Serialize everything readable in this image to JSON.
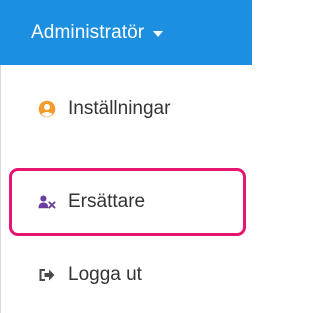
{
  "header": {
    "label": "Administratör",
    "caret_icon": "caret-down-icon",
    "background_color": "#1d8fe0"
  },
  "menu": {
    "items": [
      {
        "label": "Inställningar",
        "icon": "user-circle-icon",
        "icon_color": "#f39c2d"
      },
      {
        "label": "Ersättare",
        "icon": "user-times-icon",
        "icon_color": "#6b3fa0"
      },
      {
        "label": "Logga ut",
        "icon": "sign-out-icon",
        "icon_color": "#4a4a4a"
      }
    ]
  },
  "highlight": {
    "target": "Ersättare",
    "color": "#e6156f"
  }
}
